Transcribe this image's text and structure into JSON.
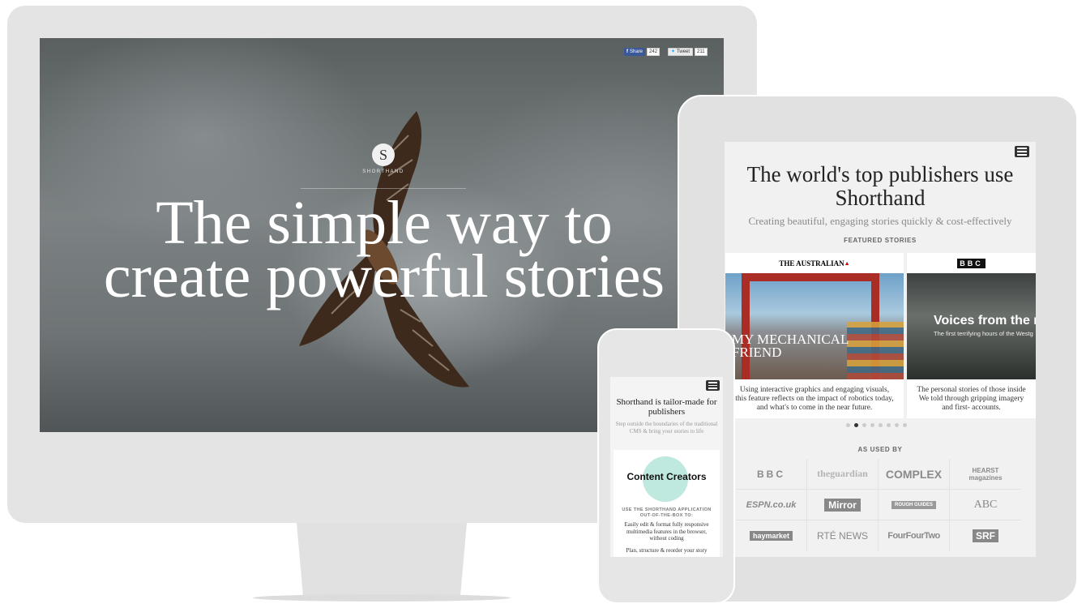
{
  "desktop": {
    "social": {
      "share_label": "Share",
      "share_count": "242",
      "tweet_label": "Tweet",
      "tweet_count": "211"
    },
    "logo_letter": "S",
    "logo_text": "SHORTHAND",
    "hero_line1": "The simple way to",
    "hero_line2": "create powerful stories"
  },
  "tablet": {
    "title_line1": "The world's top publishers use",
    "title_line2": "Shorthand",
    "subtitle": "Creating beautiful, engaging stories quickly & cost-effectively",
    "featured_label": "FEATURED STORIES",
    "cards": [
      {
        "publisher": "THE AUSTRALIAN",
        "headline_line1": "MY MECHANICAL",
        "headline_line2": "FRIEND",
        "caption": "Using interactive graphics and engaging visuals, this feature reflects on the impact of robotics today, and what's to come in the near future."
      },
      {
        "publisher": "BBC",
        "headline": "Voices from the m",
        "tagline": "The first terrifying hours of the Westg",
        "caption": "The personal stories of those inside We told through gripping imagery and first- accounts."
      }
    ],
    "dots_active": 1,
    "dots_total": 8,
    "as_used_by": "AS USED BY",
    "logos": [
      "BBC",
      "theguardian",
      "COMPLEX",
      "HEARST magazines",
      "ESPN.co.uk",
      "Mirror",
      "ROUGH GUIDES",
      "ABC",
      "haymarket",
      "RTÉ NEWS",
      "FourFourTwo",
      "SRF"
    ]
  },
  "phone": {
    "title": "Shorthand is tailor-made for publishers",
    "subtitle": "Step outside the boundaries of the traditional CMS & bring your stories to life",
    "card_title": "Content Creators",
    "use_label": "USE THE SHORTHAND APPLICATION OUT-OF-THE-BOX TO:",
    "bullet1": "Easily edit & format fully responsive multimedia features in the browser, without coding",
    "bullet2": "Plan, structure & reorder your story"
  },
  "colors": {
    "monitor": "#e4e4e4",
    "tablet_bg": "#f1f1f1",
    "accent_mint": "#bfe8df",
    "facebook": "#3b5998"
  }
}
